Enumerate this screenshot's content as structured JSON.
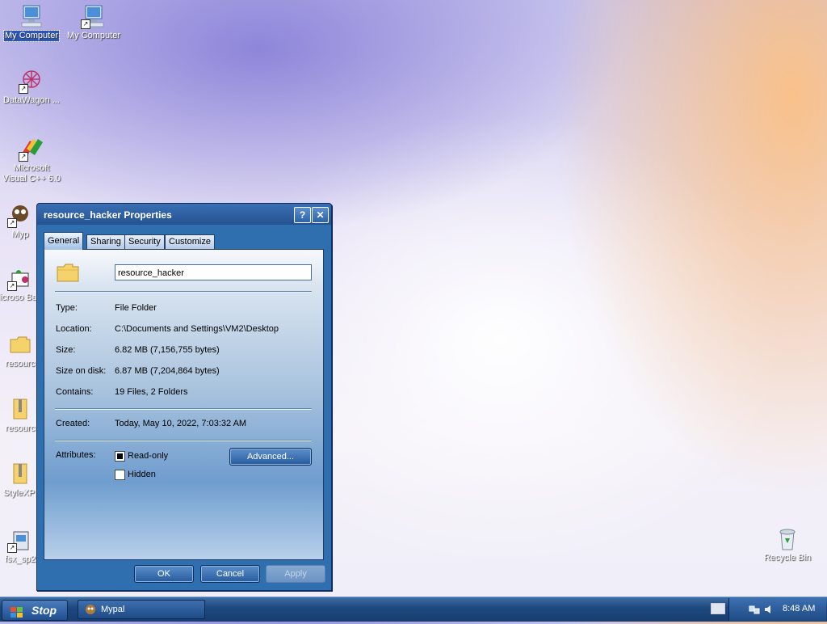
{
  "desktop": {
    "icons": [
      {
        "label": "My Computer",
        "selected": true
      },
      {
        "label": "My Computer"
      },
      {
        "label": "DataWagon ..."
      },
      {
        "label": "Microsoft Visual C++ 6.0"
      },
      {
        "label": "Myp"
      },
      {
        "label": "Microso Basic"
      },
      {
        "label": "resourc"
      },
      {
        "label": "resourc"
      },
      {
        "label": "StyleXPI"
      },
      {
        "label": "fsx_sp2"
      },
      {
        "label": "Recycle Bin"
      }
    ]
  },
  "dialog": {
    "title": "resource_hacker Properties",
    "help_glyph": "?",
    "close_glyph": "✕",
    "tabs": [
      {
        "label": "General",
        "active": true
      },
      {
        "label": "Sharing"
      },
      {
        "label": "Security"
      },
      {
        "label": "Customize"
      }
    ],
    "name_value": "resource_hacker",
    "fields": {
      "type_label": "Type:",
      "type_value": "File Folder",
      "location_label": "Location:",
      "location_value": "C:\\Documents and Settings\\VM2\\Desktop",
      "size_label": "Size:",
      "size_value": "6.82 MB (7,156,755 bytes)",
      "size_on_disk_label": "Size on disk:",
      "size_on_disk_value": "6.87 MB (7,204,864 bytes)",
      "contains_label": "Contains:",
      "contains_value": "19 Files, 2 Folders",
      "created_label": "Created:",
      "created_value": "Today, May 10, 2022, 7:03:32 AM",
      "attributes_label": "Attributes:"
    },
    "attributes": {
      "readonly_label": "Read-only",
      "readonly_checked": true,
      "hidden_label": "Hidden",
      "hidden_checked": false,
      "advanced_label": "Advanced..."
    },
    "buttons": {
      "ok": "OK",
      "cancel": "Cancel",
      "apply": "Apply"
    }
  },
  "taskbar": {
    "start_label": "Stop",
    "task_label": "Mypal",
    "clock": "8:48 AM"
  }
}
